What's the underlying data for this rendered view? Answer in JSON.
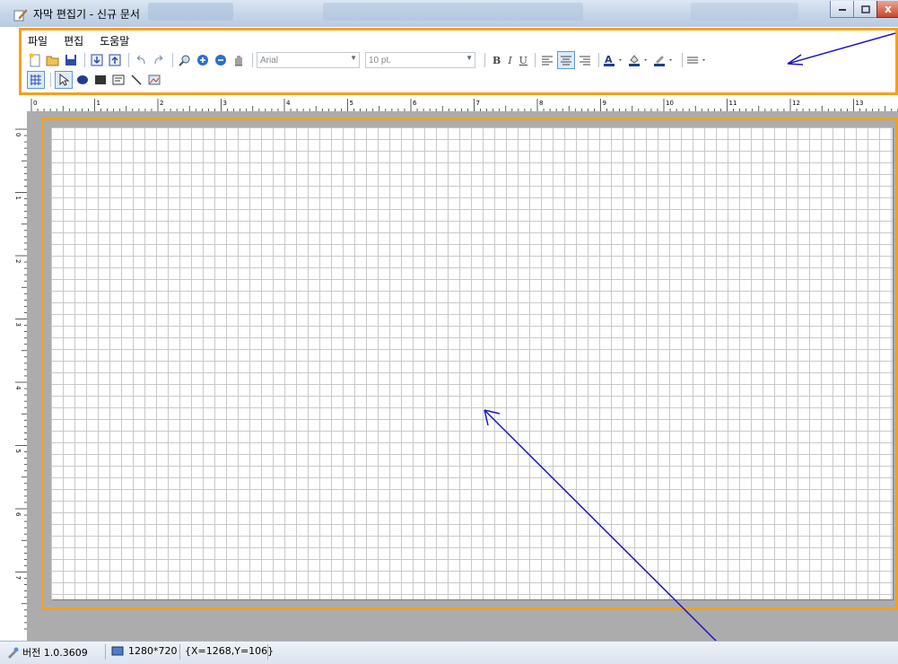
{
  "window": {
    "title": "자막 편집기 - 신규 문서"
  },
  "menu": {
    "file": "파일",
    "edit": "편집",
    "help": "도움말"
  },
  "toolbar": {
    "font": {
      "value": "Arial"
    },
    "size": {
      "value": "10 pt."
    },
    "bold": "B",
    "italic": "I",
    "underline": "U"
  },
  "status": {
    "version": "버전 1.0.3609",
    "resolution": "1280*720",
    "coords": "{X=1268,Y=106}"
  },
  "ruler": {
    "h_marks": [
      "0",
      "1",
      "2",
      "3",
      "4",
      "5",
      "6",
      "7",
      "8",
      "9",
      "10",
      "11",
      "12",
      "13"
    ],
    "v_marks": [
      "0",
      "1",
      "2",
      "3",
      "4",
      "5",
      "6",
      "7"
    ]
  },
  "colors": {
    "annotation_highlight": "#f6a01b",
    "arrow": "#1a14c8"
  }
}
